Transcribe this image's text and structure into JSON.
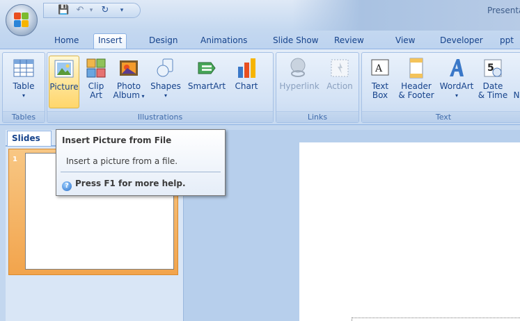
{
  "window": {
    "title": "Presenta"
  },
  "tabs": [
    {
      "label": "Home"
    },
    {
      "label": "Insert"
    },
    {
      "label": "Design"
    },
    {
      "label": "Animations"
    },
    {
      "label": "Slide Show"
    },
    {
      "label": "Review"
    },
    {
      "label": "View"
    },
    {
      "label": "Developer"
    },
    {
      "label": "ppt"
    }
  ],
  "ribbon": {
    "tables": {
      "label": "Tables",
      "table": "Table"
    },
    "illustrations": {
      "label": "Illustrations",
      "picture": "Picture",
      "clip": "Clip",
      "clip2": "Art",
      "photo": "Photo",
      "photo2": "Album",
      "shapes": "Shapes",
      "smartart": "SmartArt",
      "chart": "Chart"
    },
    "links": {
      "label": "Links",
      "hyperlink": "Hyperlink",
      "action": "Action"
    },
    "text": {
      "label": "Text",
      "textbox": "Text",
      "textbox2": "Box",
      "header": "Header",
      "header2": "& Footer",
      "wordart": "WordArt",
      "date": "Date",
      "date2": "& Time",
      "more2": "N"
    }
  },
  "panel": {
    "slides_tab": "Slides",
    "slide_number": "1"
  },
  "tooltip": {
    "title": "Insert Picture from File",
    "description": "Insert a picture from a file.",
    "help": "Press F1 for more help."
  },
  "colors": {
    "ribbon": "#d5e3f4",
    "hot": "#ffe59a",
    "thumb_selected": "#f2a44c"
  }
}
